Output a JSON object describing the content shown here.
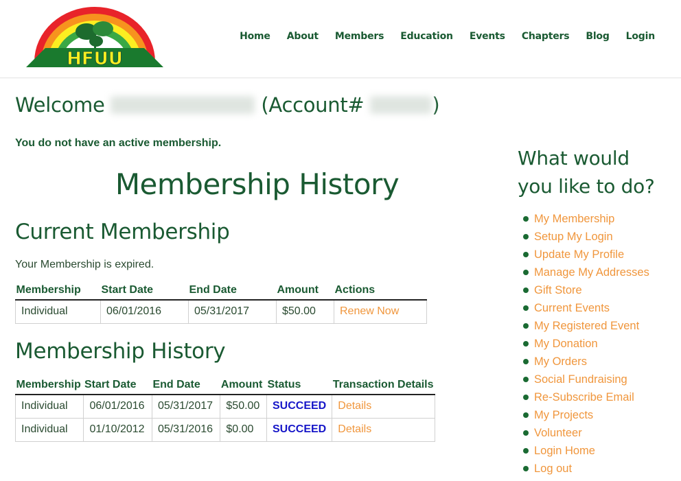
{
  "brand": {
    "logo_text": "HFUU"
  },
  "nav": [
    "Home",
    "About",
    "Members",
    "Education",
    "Events",
    "Chapters",
    "Blog",
    "Login"
  ],
  "welcome": {
    "prefix": "Welcome",
    "account_open": "(Account#",
    "account_close": ")"
  },
  "notice": "You do not have an active membership.",
  "history_title": "Membership History",
  "current": {
    "title": "Current Membership",
    "status_text": "Your Membership is expired.",
    "headers": [
      "Membership",
      "Start Date",
      "End Date",
      "Amount",
      "Actions"
    ],
    "row": {
      "membership": "Individual",
      "start": "06/01/2016",
      "end": "05/31/2017",
      "amount": "$50.00",
      "action": "Renew Now"
    }
  },
  "history": {
    "title": "Membership History",
    "headers": [
      "Membership",
      "Start Date",
      "End Date",
      "Amount",
      "Status",
      "Transaction Details"
    ],
    "rows": [
      {
        "membership": "Individual",
        "start": "06/01/2016",
        "end": "05/31/2017",
        "amount": "$50.00",
        "status": "SUCCEED",
        "details": "Details"
      },
      {
        "membership": "Individual",
        "start": "01/10/2012",
        "end": "05/31/2016",
        "amount": "$0.00",
        "status": "SUCCEED",
        "details": "Details"
      }
    ]
  },
  "sidebar": {
    "title_line1": "What would",
    "title_line2": "you like to do?",
    "items": [
      "My Membership",
      "Setup My Login",
      "Update My Profile",
      "Manage My Addresses",
      "Gift Store",
      "Current Events",
      "My Registered Event",
      "My Donation",
      "My Orders",
      "Social Fundraising",
      "Re-Subscribe Email",
      "My Projects",
      "Volunteer",
      "Login Home",
      "Log out"
    ]
  },
  "colors": {
    "primary": "#1a5a32",
    "link": "#f0963c",
    "succeed": "#1616c8"
  }
}
